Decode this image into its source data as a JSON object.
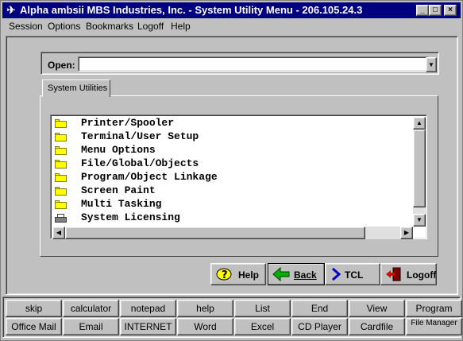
{
  "window": {
    "title": "Alpha ambsii MBS Industries, Inc. - System Utility Menu - 206.105.24.3",
    "buttons": {
      "minimize": "_",
      "maximize": "□",
      "close": "×"
    }
  },
  "menu": [
    "Session",
    "Options",
    "Bookmarks",
    "Logoff",
    "Help"
  ],
  "open": {
    "label": "Open:",
    "value": ""
  },
  "tabs": [
    {
      "label": "System Utilities",
      "active": true
    }
  ],
  "list": {
    "items": [
      {
        "label": "Printer/Spooler",
        "icon": "folder-icon"
      },
      {
        "label": "Terminal/User Setup",
        "icon": "folder-icon"
      },
      {
        "label": "Menu Options",
        "icon": "folder-icon"
      },
      {
        "label": "File/Global/Objects",
        "icon": "folder-icon"
      },
      {
        "label": "Program/Object Linkage",
        "icon": "folder-icon"
      },
      {
        "label": "Screen Paint",
        "icon": "folder-icon"
      },
      {
        "label": "Multi Tasking",
        "icon": "folder-icon"
      },
      {
        "label": "System Licensing",
        "icon": "printer-icon"
      }
    ]
  },
  "actions": [
    {
      "label": "Help",
      "icon": "help-icon"
    },
    {
      "label": "Back",
      "icon": "back-arrow-icon"
    },
    {
      "label": "TCL",
      "icon": "tcl-chevron-icon"
    },
    {
      "label": "Logoff",
      "icon": "logoff-door-icon"
    }
  ],
  "bottom_buttons": {
    "row1": [
      "skip",
      "calculator",
      "notepad",
      "help",
      "List",
      "End",
      "View",
      "Program"
    ],
    "row2": [
      "Office Mail",
      "Email",
      "INTERNET",
      "Word",
      "Excel",
      "CD Player",
      "Cardfile",
      "File Manager"
    ]
  },
  "colors": {
    "titlebar": "#000080",
    "face": "#c0c0c0",
    "folder": "#ffff00"
  }
}
